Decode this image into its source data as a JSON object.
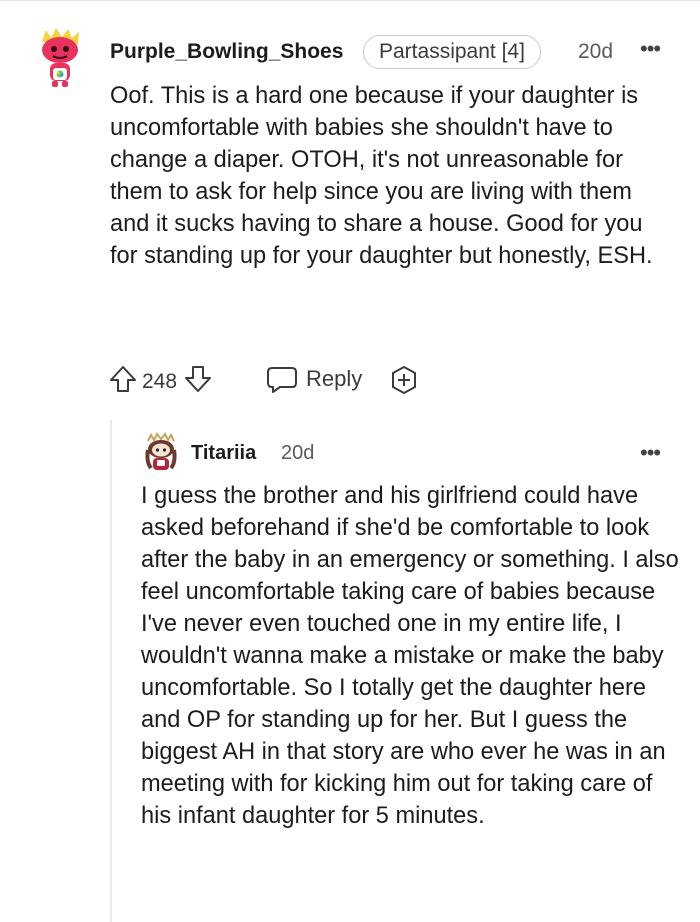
{
  "comment": {
    "author": "Purple_Bowling_Shoes",
    "flair": "Partassipant [4]",
    "time": "20d",
    "more": "•••",
    "text": "Oof. This is a hard one because if your daughter is uncomfortable with babies she shouldn't have to change a diaper. OTOH, it's not unreasonable for them to ask for help since you are living with them and it sucks having to share a house. Good for you for standing up for your daughter but honestly, ESH.",
    "votes": "248",
    "reply_label": "Reply",
    "avatar_icon": "snoo-avatar-pink",
    "upvote_icon": "upvote-arrow-icon",
    "downvote_icon": "downvote-arrow-icon",
    "reply_icon": "speech-bubble-icon",
    "award_icon": "add-award-icon"
  },
  "reply": {
    "author": "Titariia",
    "time": "20d",
    "more": "•••",
    "text": "I guess the brother and his girlfriend could have asked beforehand if she'd be comfortable to look after the baby in an emergency or something. I also feel uncomfortable taking care of babies because I've never even touched one in my entire life, I wouldn't wanna make a mistake or make the baby uncomfortable. So I totally get the daughter here and OP for standing up for her. But I guess the biggest AH in that story are who ever he was in an meeting with for kicking him out for taking care of his infant daughter for 5 minutes.",
    "avatar_icon": "snoo-avatar-girl"
  },
  "colors": {
    "text": "#1c1c1c",
    "meta": "#5a5a5a",
    "flair_border": "#c9c9c9",
    "avatar_pink": "#e8335f",
    "avatar_hair": "#f4d33c",
    "thread_line": "#e9e9e9"
  }
}
